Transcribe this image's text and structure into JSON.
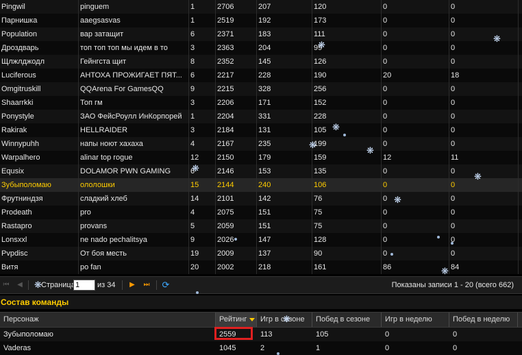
{
  "players": {
    "rows": [
      [
        "Pingwil",
        "pinguem",
        "1",
        "2706",
        "207",
        "120",
        "0",
        "0"
      ],
      [
        "Парнишка",
        "aaegsasvas",
        "1",
        "2519",
        "192",
        "173",
        "0",
        "0"
      ],
      [
        "Population",
        "вар затащит",
        "6",
        "2371",
        "183",
        "111",
        "0",
        "0"
      ],
      [
        "Дроздварь",
        "топ топ топ мы идем в то",
        "3",
        "2363",
        "204",
        "99",
        "0",
        "0"
      ],
      [
        "Щлжлджодл",
        "Гейнгста щит",
        "8",
        "2352",
        "145",
        "126",
        "0",
        "0"
      ],
      [
        "Luciferous",
        "АНТОХА ПРОЖИГАЕТ ПЯТ...",
        "6",
        "2217",
        "228",
        "190",
        "20",
        "18"
      ],
      [
        "Omgitruskill",
        "QQArena For GamesQQ",
        "9",
        "2215",
        "328",
        "256",
        "0",
        "0"
      ],
      [
        "Shaarrkki",
        "Топ гм",
        "3",
        "2206",
        "171",
        "152",
        "0",
        "0"
      ],
      [
        "Ponystyle",
        "ЗАО ФейсРоулл ИнКорпорей",
        "1",
        "2204",
        "331",
        "228",
        "0",
        "0"
      ],
      [
        "Rakirak",
        "HELLRAIDER",
        "3",
        "2184",
        "131",
        "105",
        "0",
        "0"
      ],
      [
        "Winnypuhh",
        "напы ноют хахаха",
        "4",
        "2167",
        "235",
        "199",
        "0",
        "0"
      ],
      [
        "Warpalhero",
        "alinar top rogue",
        "12",
        "2150",
        "179",
        "159",
        "12",
        "11"
      ],
      [
        "Equsix",
        "DOLAMOR PWN GAMING",
        "6",
        "2146",
        "153",
        "135",
        "0",
        "0"
      ],
      [
        "Зубыполомаю",
        "ололошки",
        "15",
        "2144",
        "240",
        "106",
        "0",
        "0"
      ],
      [
        "Фрутниндзя",
        "сладкий хлеб",
        "14",
        "2101",
        "142",
        "76",
        "0",
        "0"
      ],
      [
        "Prodeath",
        "pro",
        "4",
        "2075",
        "151",
        "75",
        "0",
        "0"
      ],
      [
        "Rastapro",
        "provans",
        "5",
        "2059",
        "151",
        "75",
        "0",
        "0"
      ],
      [
        "Lonsxxl",
        "ne nado pechalitsya",
        "9",
        "2026",
        "147",
        "128",
        "0",
        "0"
      ],
      [
        "Pvpdisc",
        "От боя месть",
        "19",
        "2009",
        "137",
        "90",
        "0",
        "0"
      ],
      [
        "Витя",
        "po fan",
        "20",
        "2002",
        "218",
        "161",
        "86",
        "84"
      ]
    ],
    "highlighted_row": 13
  },
  "pager": {
    "page_label": "Страница",
    "page_value": "1",
    "of_label": "из 34",
    "info": "Показаны записи 1 - 20 (всего 662)"
  },
  "team": {
    "title": "Состав команды",
    "headers": [
      "Персонаж",
      "Рейтинг",
      "Игр в сезоне",
      "Побед в сезоне",
      "Игр в неделю",
      "Побед в неделю"
    ],
    "rows": [
      [
        "Зубыполомаю",
        "2559",
        "113",
        "105",
        "0",
        "0"
      ],
      [
        "Vaderas",
        "1045",
        "2",
        "1",
        "0",
        "0"
      ]
    ]
  },
  "colors": {
    "highlight": "#ffcc00",
    "marker": "#e02020",
    "background": "#000000"
  }
}
